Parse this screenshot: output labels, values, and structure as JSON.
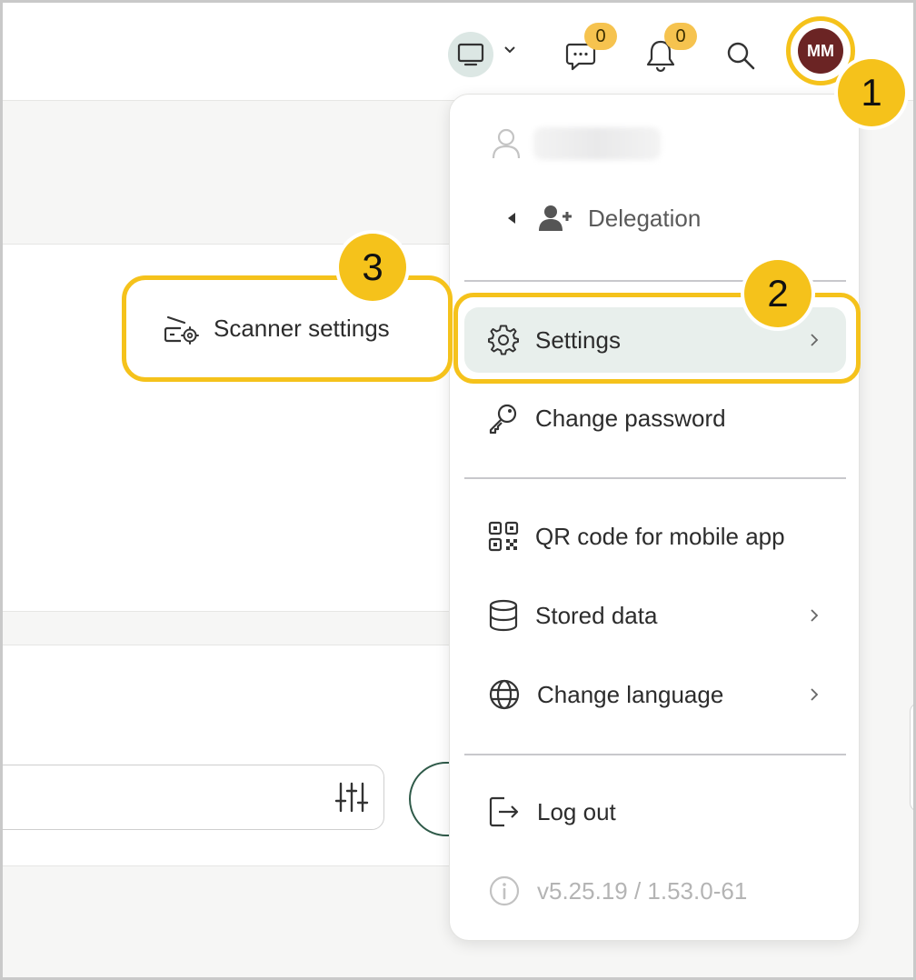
{
  "header": {
    "chat_count": "0",
    "notification_count": "0",
    "avatar_initials": "MM"
  },
  "steps": [
    "1",
    "2",
    "3"
  ],
  "scanner": {
    "label": "Scanner settings"
  },
  "menu": {
    "delegation_label": "Delegation",
    "items": [
      {
        "label": "Settings",
        "icon": "gear-icon",
        "has_submenu": true
      },
      {
        "label": "Change password",
        "icon": "key-icon",
        "has_submenu": false
      },
      {
        "label": "QR code for mobile app",
        "icon": "qr-code-icon",
        "has_submenu": false
      },
      {
        "label": "Stored data",
        "icon": "database-icon",
        "has_submenu": true
      },
      {
        "label": "Change language",
        "icon": "globe-icon",
        "has_submenu": true
      },
      {
        "label": "Log out",
        "icon": "logout-icon",
        "has_submenu": false
      }
    ],
    "version": "v5.25.19 / 1.53.0-61"
  },
  "colors": {
    "highlight": "#f5c21b",
    "avatar_bg": "#6b2424",
    "badge": "#f6c34f",
    "active_item_bg": "#e8efec",
    "accent_green": "#2f5a49"
  }
}
